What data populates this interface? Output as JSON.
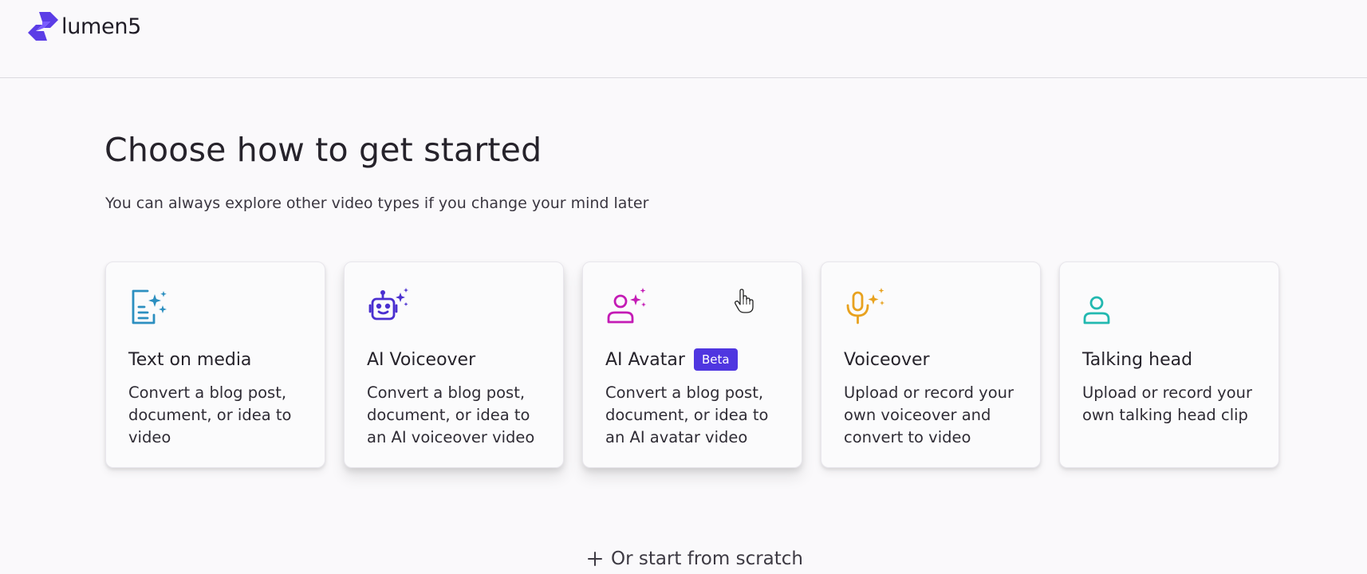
{
  "brand": {
    "name": "lumen5",
    "accent_color": "#5b3de6"
  },
  "page": {
    "title": "Choose how to get started",
    "subtitle": "You can always explore other video types if you change your mind later"
  },
  "cards": [
    {
      "title": "Text on media",
      "description": "Convert a blog post, document, or idea to video",
      "icon": "document-sparkle-icon",
      "icon_color": "#2c8fc0"
    },
    {
      "title": "AI Voiceover",
      "description": "Convert a blog post, document, or idea to an AI voiceover video",
      "icon": "robot-sparkle-icon",
      "icon_color": "#4a2fd0"
    },
    {
      "title": "AI Avatar",
      "badge": "Beta",
      "description": "Convert a blog post, document, or idea to an AI avatar video",
      "icon": "person-sparkle-icon",
      "icon_color": "#c41bb5"
    },
    {
      "title": "Voiceover",
      "description": "Upload or record your own voiceover and convert to video",
      "icon": "microphone-sparkle-icon",
      "icon_color": "#e8a21f"
    },
    {
      "title": "Talking head",
      "description": "Upload or record your own talking head clip",
      "icon": "person-icon",
      "icon_color": "#22b8b0"
    }
  ],
  "footer": {
    "scratch_label": "Or start from scratch"
  }
}
